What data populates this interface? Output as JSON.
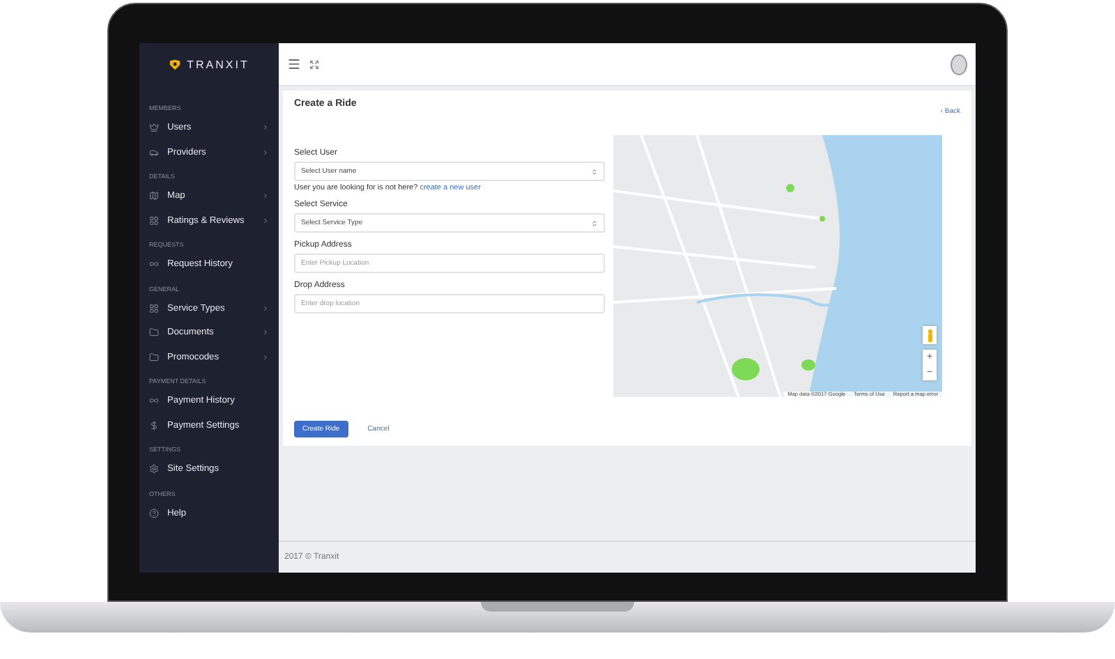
{
  "brand": {
    "name": "TRANXIT"
  },
  "sidebar": {
    "sections": [
      {
        "heading": "MEMBERS",
        "items": [
          {
            "label": "Users",
            "submenu": true
          },
          {
            "label": "Providers",
            "submenu": true
          }
        ]
      },
      {
        "heading": "DETAILS",
        "items": [
          {
            "label": "Map",
            "submenu": true
          },
          {
            "label": "Ratings & Reviews",
            "submenu": true
          }
        ]
      },
      {
        "heading": "REQUESTS",
        "items": [
          {
            "label": "Request History",
            "submenu": false
          }
        ]
      },
      {
        "heading": "GENERAL",
        "items": [
          {
            "label": "Service Types",
            "submenu": true
          },
          {
            "label": "Documents",
            "submenu": true
          },
          {
            "label": "Promocodes",
            "submenu": true
          }
        ]
      },
      {
        "heading": "PAYMENT DETAILS",
        "items": [
          {
            "label": "Payment History",
            "submenu": false
          },
          {
            "label": "Payment Settings",
            "submenu": false
          }
        ]
      },
      {
        "heading": "SETTINGS",
        "items": [
          {
            "label": "Site Settings",
            "submenu": false
          }
        ]
      },
      {
        "heading": "OTHERS",
        "items": [
          {
            "label": "Help",
            "submenu": false
          }
        ]
      }
    ]
  },
  "page": {
    "title": "Create a Ride",
    "back": "‹ Back"
  },
  "form": {
    "fields": [
      {
        "kind": "select",
        "label": "Select User",
        "value": "Select User name",
        "hint": "User you are looking for is not here?",
        "hint_link": "create a new user"
      },
      {
        "kind": "select",
        "label": "Select Service",
        "value": "Select Service Type"
      },
      {
        "kind": "input",
        "label": "Pickup Address",
        "placeholder": "Enter Pickup Location"
      },
      {
        "kind": "input",
        "label": "Drop Address",
        "placeholder": "Enter drop location"
      }
    ],
    "buttons": [
      {
        "kind": "primary",
        "label": "Create Ride"
      },
      {
        "kind": "link",
        "label": "Cancel"
      }
    ]
  },
  "map": {
    "zoom_in": "+",
    "zoom_out": "−",
    "attribution": [
      "Map data ©2017 Google",
      "Terms of Use",
      "Report a map error"
    ]
  },
  "footer": {
    "text": "2017 © Tranxit"
  }
}
